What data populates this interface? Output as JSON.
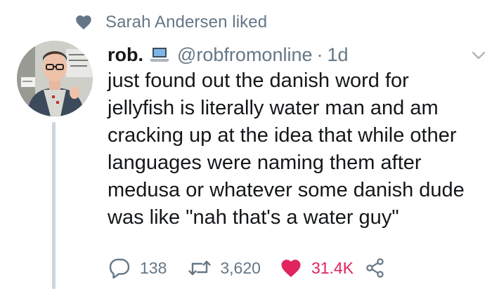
{
  "context": {
    "text": "Sarah Andersen liked",
    "icon": "heart-icon"
  },
  "tweet": {
    "author": {
      "display_name": "rob.",
      "handle": "@robfromonline",
      "badge_icon": "laptop-icon"
    },
    "separator": "·",
    "time": "1d",
    "text": "just found out the danish word for\njellyfish is literally water man and am\ncracking up at the idea that while other\nlanguages were naming them after\nmedusa or whatever some danish dude\nwas like \"nah that's a water guy\"",
    "stats": {
      "replies": "138",
      "retweets": "3,620",
      "likes": "31.4K"
    },
    "liked": true
  },
  "colors": {
    "muted": "#657786",
    "text": "#14171a",
    "like": "#e0245e",
    "thread_line": "#ccd6dd"
  }
}
